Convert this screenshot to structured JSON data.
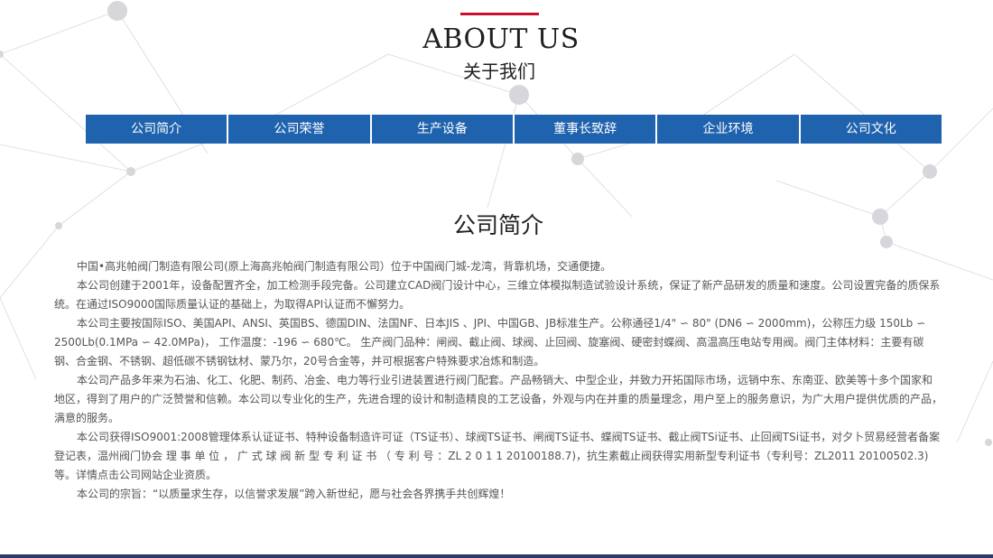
{
  "header": {
    "title_en": "ABOUT US",
    "title_cn": "关于我们"
  },
  "nav": {
    "items": [
      {
        "label": "公司简介"
      },
      {
        "label": "公司荣誉"
      },
      {
        "label": "生产设备"
      },
      {
        "label": "董事长致辞"
      },
      {
        "label": "企业环境"
      },
      {
        "label": "公司文化"
      }
    ]
  },
  "section": {
    "title": "公司简介",
    "paragraphs": [
      "中国•高兆帕阀门制造有限公司(原上海高兆帕阀门制造有限公司）位于中国阀门城-龙湾，背靠机场，交通便捷。",
      "本公司创建于2001年，设备配置齐全，加工检测手段完备。公司建立CAD阀门设计中心，三维立体模拟制造试验设计系统，保证了新产品研发的质量和速度。公司设置完备的质保系统。在通过ISO9000国际质量认证的基础上，为取得API认证而不懈努力。",
      "本公司主要按国际ISO、美国API、ANSI、英国BS、德国DIN、法国NF、日本JIS 、JPI、中国GB、JB标准生产。公称通径1/4\" ∽ 80\" (DN6 ∽ 2000mm)，公称压力级 150Lb ∽ 2500Lb(0.1MPa ∽ 42.0MPa)， 工作温度：-196 ∽ 680℃。 生产阀门品种：闸阀、截止阀、球阀、止回阀、旋塞阀、硬密封蝶阀、高温高压电站专用阀。阀门主体材料：主要有碳钢、合金钢、不锈钢、超低碳不锈钢钛材、蒙乃尔，20号合金等，并可根据客户特殊要求冶炼和制造。",
      "本公司产品多年来为石油、化工、化肥、制药、冶金、电力等行业引进装置进行阀门配套。产品畅销大、中型企业，并致力开拓国际市场，远销中东、东南亚、欧美等十多个国家和地区，得到了用户的广泛赞誉和信赖。本公司以专业化的生产，先进合理的设计和制造精良的工艺设备，外观与内在并重的质量理念，用户至上的服务意识，为广大用户提供优质的产品，满意的服务。",
      "本公司获得ISO9001:2008管理体系认证证书、特种设备制造许可证（TS证书）、球阀TS证书、闸阀TS证书、蝶阀TS证书、截止阀TSi证书、止回阀TSi证书，对夕卜贸易经营者备案登记表，温州阀门协会 理 事 单 位 ， 广 式 球 阀 新 型 专 利 证 书 （ 专 利 号 ：ZL 2 0 1 1 20100188.7)，抗生素截止阀获得实用新型专利证书（专利号：ZL2011 20100502.3)等。详情点击公司网站企业资质。",
      "本公司的宗旨：“以质量求生存，以信誉求发展”跨入新世纪，愿与社会各界携手共创辉煌！"
    ]
  },
  "colors": {
    "accent_red": "#c8102e",
    "nav_blue": "#1f62ad",
    "text_gray": "#555555",
    "title_dark": "#1f1f1f"
  }
}
